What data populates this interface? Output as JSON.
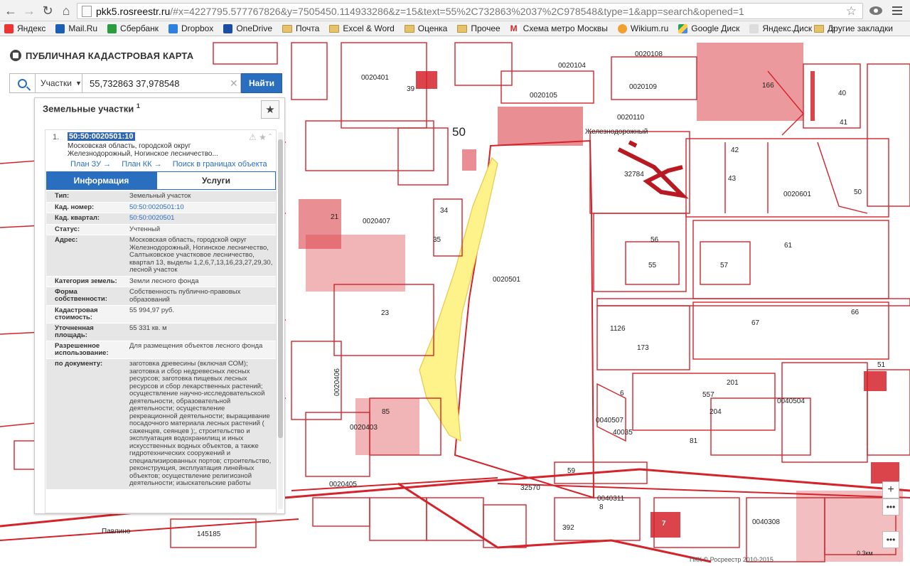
{
  "browser": {
    "url_host": "pkk5.rosreestr.ru",
    "url_path": "/#x=4227795.577767826&y=7505450.114933286&z=15&text=55%2C732863%2037%2C978548&type=1&app=search&opened=1"
  },
  "bookmarks": {
    "items": [
      "Яндекс",
      "Mail.Ru",
      "Сбербанк",
      "Dropbox",
      "OneDrive",
      "Почта",
      "Excel & Word",
      "Оценка",
      "Прочее",
      "Схема метро Москвы",
      "Wikium.ru",
      "Google Диск",
      "Яндекс.Диск"
    ],
    "other": "Другие закладки"
  },
  "app": {
    "logo_text": "ПУБЛИЧНАЯ КАДАСТРОВАЯ КАРТА",
    "search_type": "Участки",
    "search_value": "55,732863 37,978548",
    "find_button": "Найти"
  },
  "panel": {
    "title": "Земельные участки",
    "title_count": "1",
    "result_number": "1.",
    "cad_number": "50:50:0020501:10",
    "address_short_1": "Московская область, городской округ",
    "address_short_2": "Железнодорожный, Ногинское лесничество...",
    "links": [
      "План ЗУ →",
      "План КК →",
      "Поиск в границах объекта →"
    ],
    "tab_info": "Информация",
    "tab_services": "Услуги",
    "props": [
      {
        "k": "Тип:",
        "v": "Земельный участок"
      },
      {
        "k": "Кад. номер:",
        "v": "50:50:0020501:10"
      },
      {
        "k": "Кад. квартал:",
        "v": "50:50:0020501"
      },
      {
        "k": "Статус:",
        "v": "Учтенный"
      },
      {
        "k": "Адрес:",
        "v": "Московская область, городской округ Железнодорожный, Ногинское лесничество, Салтыковское участковое лесничество, квартал 13, выделы 1,2,6,7,13,16,23,27,29,30, лесной участок"
      },
      {
        "k": "Категория земель:",
        "v": "Земли лесного фонда"
      },
      {
        "k": "Форма собственности:",
        "v": "Собственность публично-правовых образований"
      },
      {
        "k": "Кадастровая стоимость:",
        "v": "55 994,97 руб."
      },
      {
        "k": "Уточненная площадь:",
        "v": "55 331 кв. м"
      },
      {
        "k": "Разрешенное использование:",
        "v": "Для размещения объектов лесного фонда"
      },
      {
        "k": "по документу:",
        "v": "заготовка древесины (включая СОМ); заготовка и сбор недревесных лесных ресурсов; заготовка пищевых лесных ресурсов и сбор лекарственных растений; осуществление научно-исследовательской деятельности, образовательной деятельности; осуществление рекреационной деятельности; выращивание посадочного материала лесных растений ( саженцев, сеянцев );, строительство и эксплуатация водохранилищ и иных искусственных водных объектов, а также гидротехнических сооружений и специализированных портов; строительство, реконструкция, эксплуатация линейных объектов; осуществление религиозной деятельности; изыскательские работы"
      }
    ]
  },
  "map": {
    "labels": [
      {
        "t": "0020108",
        "s": "lbl"
      },
      {
        "t": "0020104",
        "s": "lbl"
      },
      {
        "t": "0020105",
        "s": "lbl"
      },
      {
        "t": "0020109",
        "s": "lbl"
      },
      {
        "t": "0020110",
        "s": "lbl"
      },
      {
        "t": "0020401",
        "s": "lbl"
      },
      {
        "t": "0020407",
        "s": "lbl"
      },
      {
        "t": "0020501",
        "s": "lbl"
      },
      {
        "t": "0020601",
        "s": "lbl"
      },
      {
        "t": "0020406",
        "s": "lbl"
      },
      {
        "t": "0020403",
        "s": "lbl"
      },
      {
        "t": "0020405",
        "s": "lbl"
      },
      {
        "t": "0040507",
        "s": "lbl"
      },
      {
        "t": "0040504",
        "s": "lbl"
      },
      {
        "t": "0040311",
        "s": "lbl"
      },
      {
        "t": "0040308",
        "s": "lbl"
      },
      {
        "t": "Железнодорожный",
        "s": "lbl"
      },
      {
        "t": "Павлино",
        "s": "lbl"
      },
      {
        "t": "50",
        "s": "lbl-xl"
      },
      {
        "t": "32784",
        "s": "lbl"
      },
      {
        "t": "40035",
        "s": "lbl"
      },
      {
        "t": "32570",
        "s": "lbl"
      },
      {
        "t": "145185",
        "s": "lbl"
      },
      {
        "t": "55",
        "s": "lbl"
      },
      {
        "t": "57",
        "s": "lbl"
      },
      {
        "t": "56",
        "s": "lbl"
      },
      {
        "t": "61",
        "s": "lbl"
      },
      {
        "t": "35",
        "s": "lbl"
      },
      {
        "t": "34",
        "s": "lbl"
      },
      {
        "t": "23",
        "s": "lbl"
      },
      {
        "t": "173",
        "s": "lbl"
      },
      {
        "t": "201",
        "s": "lbl"
      },
      {
        "t": "204",
        "s": "lbl"
      },
      {
        "t": "81",
        "s": "lbl"
      },
      {
        "t": "66",
        "s": "lbl"
      },
      {
        "t": "67",
        "s": "lbl"
      },
      {
        "t": "50",
        "s": "lbl"
      },
      {
        "t": "8",
        "s": "lbl"
      },
      {
        "t": "59",
        "s": "lbl"
      },
      {
        "t": "392",
        "s": "lbl"
      },
      {
        "t": "7",
        "s": "lbl"
      },
      {
        "t": "40",
        "s": "lbl"
      },
      {
        "t": "41",
        "s": "lbl"
      },
      {
        "t": "42",
        "s": "lbl"
      },
      {
        "t": "43",
        "s": "lbl"
      },
      {
        "t": "166",
        "s": "lbl"
      },
      {
        "t": "21",
        "s": "lbl"
      },
      {
        "t": "85",
        "s": "lbl"
      },
      {
        "t": "39",
        "s": "lbl"
      },
      {
        "t": "51",
        "s": "lbl"
      },
      {
        "t": "1126",
        "s": "lbl"
      },
      {
        "t": "557",
        "s": "lbl"
      },
      {
        "t": "6",
        "s": "lbl"
      }
    ],
    "copyright": "ПКК © Росреестр 2010-2015",
    "scale": "0.3км",
    "zoom_in": "+",
    "zoom_out": "−"
  }
}
